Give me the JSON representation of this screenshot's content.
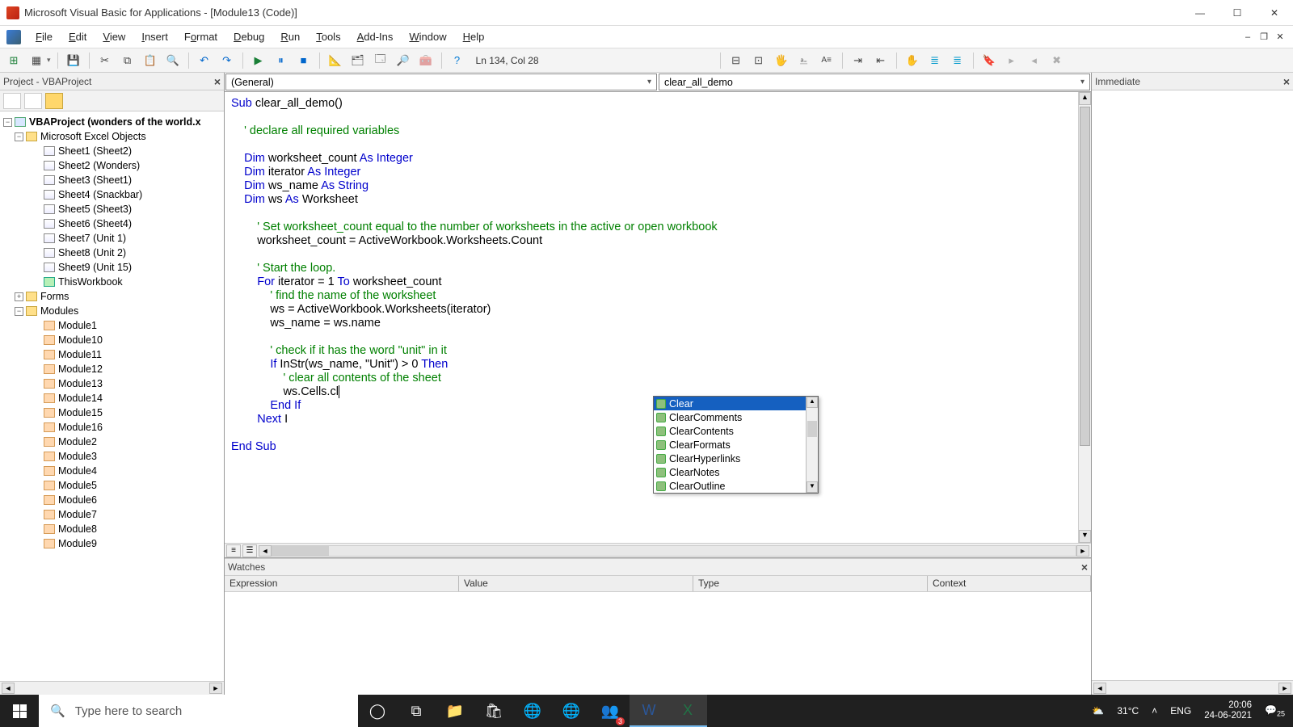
{
  "titlebar": {
    "title": "Microsoft Visual Basic for Applications - [Module13 (Code)]"
  },
  "menu": {
    "file": "File",
    "edit": "Edit",
    "view": "View",
    "insert": "Insert",
    "format": "Format",
    "debug": "Debug",
    "run": "Run",
    "tools": "Tools",
    "addins": "Add-Ins",
    "window": "Window",
    "help": "Help"
  },
  "toolbar": {
    "pos": "Ln 134, Col 28"
  },
  "project_pane": {
    "title": "Project - VBAProject"
  },
  "tree": {
    "root": "VBAProject (wonders of the world.x",
    "excel_objects": "Microsoft Excel Objects",
    "sheets": [
      "Sheet1 (Sheet2)",
      "Sheet2 (Wonders)",
      "Sheet3 (Sheet1)",
      "Sheet4 (Snackbar)",
      "Sheet5 (Sheet3)",
      "Sheet6 (Sheet4)",
      "Sheet7 (Unit 1)",
      "Sheet8 (Unit 2)",
      "Sheet9 (Unit 15)"
    ],
    "thisworkbook": "ThisWorkbook",
    "forms": "Forms",
    "modules": "Modules",
    "module_list": [
      "Module1",
      "Module10",
      "Module11",
      "Module12",
      "Module13",
      "Module14",
      "Module15",
      "Module16",
      "Module2",
      "Module3",
      "Module4",
      "Module5",
      "Module6",
      "Module7",
      "Module8",
      "Module9"
    ]
  },
  "dropdowns": {
    "left": "(General)",
    "right": "clear_all_demo"
  },
  "code": {
    "l1a": "Sub",
    "l1b": " clear_all_demo()",
    "l2": "    ' declare all required variables",
    "l3a": "    Dim",
    "l3b": " worksheet_count ",
    "l3c": "As Integer",
    "l4a": "    Dim",
    "l4b": " iterator ",
    "l4c": "As Integer",
    "l5a": "    Dim",
    "l5b": " ws_name ",
    "l5c": "As String",
    "l6a": "    Dim",
    "l6b": " ws ",
    "l6c": "As",
    "l6d": " Worksheet",
    "l7": "        ' Set worksheet_count equal to the number of worksheets in the active or open workbook",
    "l8": "        worksheet_count = ActiveWorkbook.Worksheets.Count",
    "l9": "        ' Start the loop.",
    "l10a": "        For",
    "l10b": " iterator = 1 ",
    "l10c": "To",
    "l10d": " worksheet_count",
    "l11": "            ' find the name of the worksheet",
    "l12": "            ws = ActiveWorkbook.Worksheets(iterator)",
    "l13": "            ws_name = ws.name",
    "l14": "            ' check if it has the word \"unit\" in it",
    "l15a": "            If",
    "l15b": " InStr(ws_name, \"Unit\") > 0 ",
    "l15c": "Then",
    "l16": "                ' clear all contents of the sheet",
    "l17": "                ws.Cells.cl",
    "l18": "            End If",
    "l19a": "        Next",
    "l19b": " I",
    "l20": "End Sub"
  },
  "intellisense": {
    "items": [
      "Clear",
      "ClearComments",
      "ClearContents",
      "ClearFormats",
      "ClearHyperlinks",
      "ClearNotes",
      "ClearOutline"
    ],
    "selected": 0
  },
  "watches": {
    "title": "Watches",
    "cols": [
      "Expression",
      "Value",
      "Type",
      "Context"
    ]
  },
  "immediate": {
    "title": "Immediate"
  },
  "taskbar": {
    "search_placeholder": "Type here to search",
    "temp": "31°C",
    "lang": "ENG",
    "time": "20:06",
    "date": "24-06-2021",
    "notif": "25"
  }
}
